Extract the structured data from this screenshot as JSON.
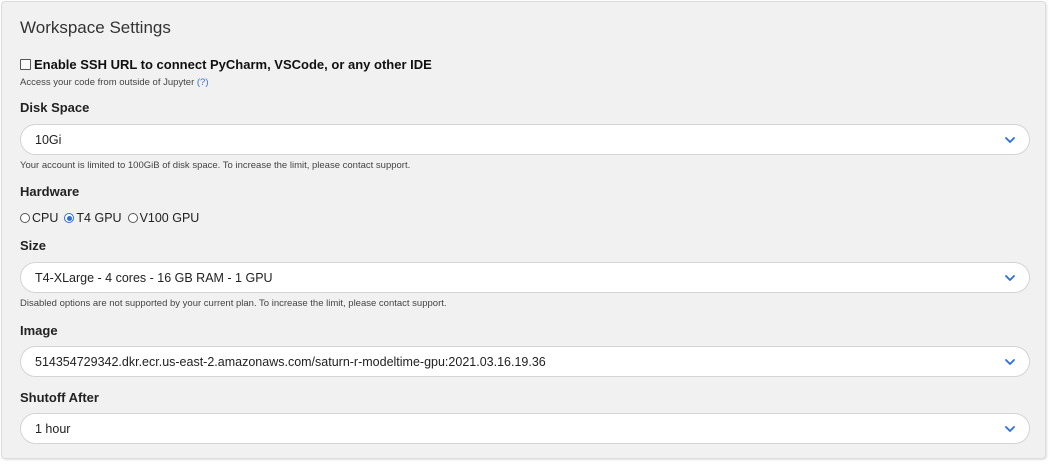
{
  "panel": {
    "title": "Workspace Settings"
  },
  "ssh": {
    "label": "Enable SSH URL to connect PyCharm, VSCode, or any other IDE",
    "checked": false,
    "help_text": "Access your code from outside of Jupyter",
    "help_link": "(?)"
  },
  "disk": {
    "label": "Disk Space",
    "value": "10Gi",
    "help_text": "Your account is limited to 100GiB of disk space. To increase the limit, please contact support."
  },
  "hardware": {
    "label": "Hardware",
    "options": [
      {
        "label": "CPU",
        "selected": false
      },
      {
        "label": "T4 GPU",
        "selected": true
      },
      {
        "label": "V100 GPU",
        "selected": false
      }
    ]
  },
  "size": {
    "label": "Size",
    "value": "T4-XLarge - 4 cores - 16 GB RAM - 1 GPU",
    "help_text": "Disabled options are not supported by your current plan. To increase the limit, please contact support."
  },
  "image": {
    "label": "Image",
    "value": "514354729342.dkr.ecr.us-east-2.amazonaws.com/saturn-r-modeltime-gpu:2021.03.16.19.36"
  },
  "shutoff": {
    "label": "Shutoff After",
    "value": "1 hour"
  },
  "colors": {
    "accent": "#2b6de0",
    "link": "#3b6fd6",
    "panel_bg": "#f1f1f1"
  }
}
